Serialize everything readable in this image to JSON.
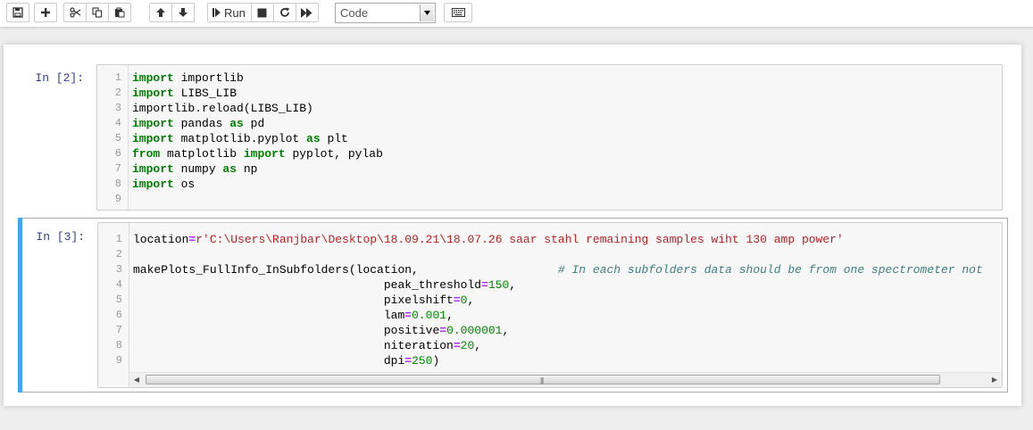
{
  "toolbar": {
    "run_label": "Run",
    "cell_type": "Code"
  },
  "cells": [
    {
      "prompt": "In [2]:",
      "lines": [
        {
          "n": "1"
        },
        {
          "n": "2"
        },
        {
          "n": "3"
        },
        {
          "n": "4"
        },
        {
          "n": "5"
        },
        {
          "n": "6"
        },
        {
          "n": "7"
        },
        {
          "n": "8"
        },
        {
          "n": "9"
        }
      ]
    },
    {
      "prompt": "In [3]:",
      "lines": [
        {
          "n": "1"
        },
        {
          "n": "2"
        },
        {
          "n": "3"
        },
        {
          "n": "4"
        },
        {
          "n": "5"
        },
        {
          "n": "6"
        },
        {
          "n": "7"
        },
        {
          "n": "8"
        },
        {
          "n": "9"
        }
      ]
    }
  ],
  "code": {
    "c1": {
      "l1_kw": "import",
      "l1_rest": " importlib",
      "l2_kw": "import",
      "l2_rest": " LIBS_LIB",
      "l3": "importlib.reload(LIBS_LIB)",
      "l4_kw": "import",
      "l4_mid": " pandas ",
      "l4_as": "as",
      "l4_rest": " pd",
      "l5_kw": "import",
      "l5_mid": " matplotlib.pyplot ",
      "l5_as": "as",
      "l5_rest": " plt",
      "l6_kw": "from",
      "l6_mid": " matplotlib ",
      "l6_imp": "import",
      "l6_rest": " pyplot, pylab",
      "l7_kw": "import",
      "l7_mid": " numpy ",
      "l7_as": "as",
      "l7_rest": " np",
      "l8_kw": "import",
      "l8_rest": " os",
      "l9": ""
    },
    "c2": {
      "l1_name": "location",
      "l1_eq": "=",
      "l1_str": "r'C:\\Users\\Ranjbar\\Desktop\\18.09.21\\18.07.26 saar stahl remaining samples wiht 130 amp power'",
      "l2": "",
      "l3_code": "makePlots_FullInfo_InSubfolders(location,                    ",
      "l3_comment": "# In each subfolders data should be from one spectrometer not",
      "l4_pre": "                                    peak_threshold",
      "l4_eq": "=",
      "l4_num": "150",
      "l4_post": ",",
      "l5_pre": "                                    pixelshift",
      "l5_eq": "=",
      "l5_num": "0",
      "l5_post": ",",
      "l6_pre": "                                    lam",
      "l6_eq": "=",
      "l6_num": "0.001",
      "l6_post": ",",
      "l7_pre": "                                    positive",
      "l7_eq": "=",
      "l7_num": "0.000001",
      "l7_post": ",",
      "l8_pre": "                                    niteration",
      "l8_eq": "=",
      "l8_num": "20",
      "l8_post": ",",
      "l9_pre": "                                    dpi",
      "l9_eq": "=",
      "l9_num": "250",
      "l9_post": ")"
    }
  },
  "scrollbar": {
    "grip": "|||"
  },
  "colors": {
    "prompt": "#303f9f",
    "keyword": "#008000",
    "string": "#ba2121",
    "number": "#080",
    "comment": "#408080",
    "selection_bar": "#42a5f5"
  }
}
